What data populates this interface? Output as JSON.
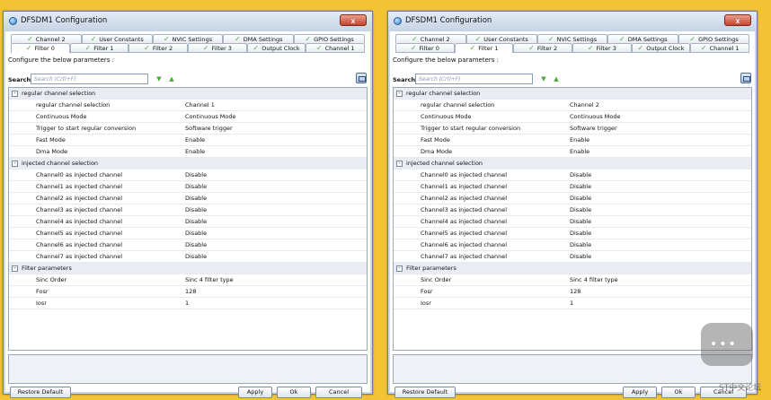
{
  "windows": [
    {
      "title": "DFSDM1 Configuration",
      "close_label": "x",
      "tabs_row1": [
        "Channel 2",
        "User Constants",
        "NVIC Settings",
        "DMA Settings",
        "GPIO Settings"
      ],
      "tabs_row2": [
        "Filter 0",
        "Filter 1",
        "Filter 2",
        "Filter 3",
        "Output Clock",
        "Channel 1"
      ],
      "active_tab": "Filter 0",
      "config_text": "Configure the below parameters :",
      "search_label": "Search :",
      "search_placeholder": "Search (Crtl+F)",
      "groups": [
        {
          "label": "regular channel selection",
          "toggle": "-",
          "rows": [
            {
              "name": "regular channel selection",
              "value": "Channel 1"
            },
            {
              "name": "Continuous Mode",
              "value": "Continuous Mode"
            },
            {
              "name": "Trigger to start regular conversion",
              "value": "Software trigger"
            },
            {
              "name": "Fast Mode",
              "value": "Enable"
            },
            {
              "name": "Dma Mode",
              "value": "Enable"
            }
          ]
        },
        {
          "label": "injected channel selection",
          "toggle": "-",
          "rows": [
            {
              "name": "Channel0 as injected channel",
              "value": "Disable"
            },
            {
              "name": "Channel1 as injected channel",
              "value": "Disable"
            },
            {
              "name": "Channel2 as injected channel",
              "value": "Disable"
            },
            {
              "name": "Channel3 as injected channel",
              "value": "Disable"
            },
            {
              "name": "Channel4 as injected channel",
              "value": "Disable"
            },
            {
              "name": "Channel5 as injected channel",
              "value": "Disable"
            },
            {
              "name": "Channel6 as injected channel",
              "value": "Disable"
            },
            {
              "name": "Channel7 as injected channel",
              "value": "Disable"
            }
          ]
        },
        {
          "label": "Filter parameters",
          "toggle": "-",
          "rows": [
            {
              "name": "Sinc Order",
              "value": "Sinc 4 filter type"
            },
            {
              "name": "Fosr",
              "value": "128"
            },
            {
              "name": "Iosr",
              "value": "1"
            }
          ]
        }
      ],
      "buttons": {
        "restore": "Restore Default",
        "apply": "Apply",
        "ok": "Ok",
        "cancel": "Cancel"
      }
    },
    {
      "title": "DFSDM1 Configuration",
      "close_label": "x",
      "tabs_row1": [
        "Channel 2",
        "User Constants",
        "NVIC Settings",
        "DMA Settings",
        "GPIO Settings"
      ],
      "tabs_row2": [
        "Filter 0",
        "Filter 1",
        "Filter 2",
        "Filter 3",
        "Output Clock",
        "Channel 1"
      ],
      "active_tab": "Filter 1",
      "config_text": "Configure the below parameters :",
      "search_label": "Search :",
      "search_placeholder": "Search (Crtl+F)",
      "groups": [
        {
          "label": "regular channel selection",
          "toggle": "-",
          "rows": [
            {
              "name": "regular channel selection",
              "value": "Channel 2"
            },
            {
              "name": "Continuous Mode",
              "value": "Continuous Mode"
            },
            {
              "name": "Trigger to start regular conversion",
              "value": "Software trigger"
            },
            {
              "name": "Fast Mode",
              "value": "Enable"
            },
            {
              "name": "Dma Mode",
              "value": "Enable"
            }
          ]
        },
        {
          "label": "injected channel selection",
          "toggle": "-",
          "rows": [
            {
              "name": "Channel0 as injected channel",
              "value": "Disable"
            },
            {
              "name": "Channel1 as injected channel",
              "value": "Disable"
            },
            {
              "name": "Channel2 as injected channel",
              "value": "Disable"
            },
            {
              "name": "Channel3 as injected channel",
              "value": "Disable"
            },
            {
              "name": "Channel4 as injected channel",
              "value": "Disable"
            },
            {
              "name": "Channel5 as injected channel",
              "value": "Disable"
            },
            {
              "name": "Channel6 as injected channel",
              "value": "Disable"
            },
            {
              "name": "Channel7 as injected channel",
              "value": "Disable"
            }
          ]
        },
        {
          "label": "Filter parameters",
          "toggle": "-",
          "rows": [
            {
              "name": "Sinc Order",
              "value": "Sinc 4 filter type"
            },
            {
              "name": "Fosr",
              "value": "128"
            },
            {
              "name": "Iosr",
              "value": "1"
            }
          ]
        }
      ],
      "buttons": {
        "restore": "Restore Default",
        "apply": "Apply",
        "ok": "Ok",
        "cancel": "Cancel"
      }
    }
  ],
  "watermark": {
    "text": "ST中文论坛"
  },
  "colors": {
    "background": "#f2c335",
    "check": "#55a33a",
    "group_row": "#e9edf3"
  }
}
